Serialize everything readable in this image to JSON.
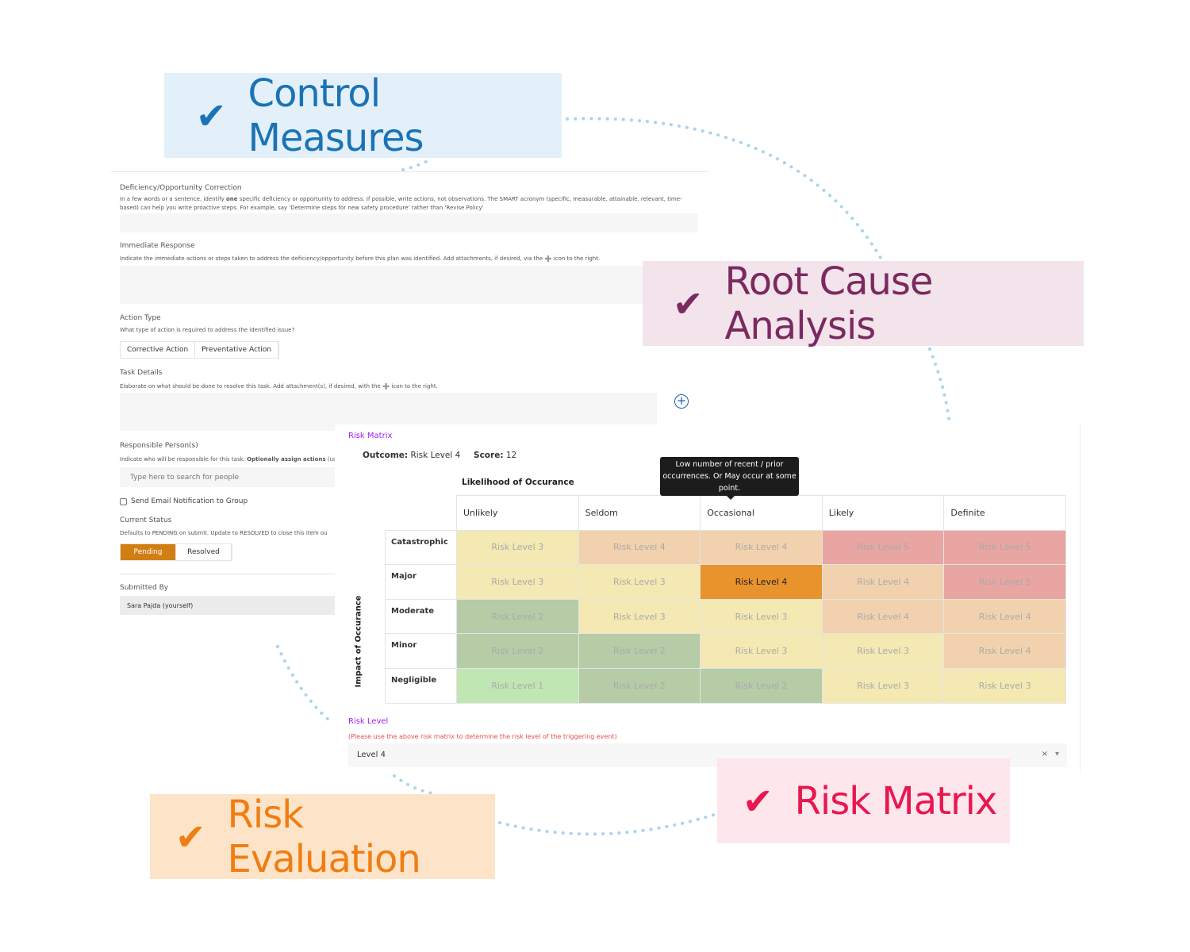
{
  "badges": {
    "control_measures": {
      "label": "Control Measures",
      "color": "#1a73b5",
      "bg": "#e3f0f9",
      "icon": "checkmark-icon"
    },
    "root_cause": {
      "label": "Root Cause Analysis",
      "color": "#7b2960",
      "bg": "#f2e4ea",
      "icon": "checkmark-icon"
    },
    "risk_matrix": {
      "label": "Risk Matrix",
      "color": "#e8174f",
      "bg": "#fde6ec",
      "icon": "checkmark-icon"
    },
    "risk_evaluation": {
      "label": "Risk Evaluation",
      "color": "#f07d12",
      "bg": "#fde4c9",
      "icon": "checkmark-icon"
    }
  },
  "form": {
    "deficiency": {
      "label": "Deficiency/Opportunity Correction",
      "hint_a": "In a few words or a sentence, identify ",
      "hint_bold": "one",
      "hint_b": " specific deficiency or opportunity to address.  If possible, write actions, not observations.  The SMART acronym (specific, measurable, attainable, relevant, time-based) can help you write proactive steps.  For example, say 'Determine steps for new safety procedure' rather than 'Revise Policy'"
    },
    "immediate": {
      "label": "Immediate Response",
      "hint_a": "Indicate the immediate actions or steps taken to address the deficiency/opportunity before this plan was identified.  Add attachments, if desired, via the ",
      "hint_b": " icon to the right."
    },
    "action_type": {
      "label": "Action Type",
      "hint": "What type of action is required to address the identified issue?",
      "options": [
        "Corrective Action",
        "Preventative Action"
      ]
    },
    "task_details": {
      "label": "Task Details",
      "hint_a": "Elaborate on what should be done to resolve this task.  Add attachment(s), if desired, with the ",
      "hint_b": " icon to the right."
    },
    "responsible": {
      "label": "Responsible Person(s)",
      "hint_a": "Indicate who will be responsible for this task.  ",
      "hint_bold": "Optionally assign actions",
      "hint_b": " (usi",
      "placeholder": "Type here to search for people"
    },
    "email_notification": "Send Email Notification to Group",
    "status": {
      "label": "Current Status",
      "hint": "Defaults to PENDING on submit.  Update to RESOLVED to close this item ou",
      "options": [
        "Pending",
        "Resolved"
      ],
      "selected": "Pending",
      "accent": "#d17f14"
    },
    "submitted_by": {
      "label": "Submitted By",
      "value": "Sara Pajda (yourself)"
    }
  },
  "matrix": {
    "title": "Risk Matrix",
    "outcome_label": "Outcome:",
    "outcome_value": "Risk Level 4",
    "score_label": "Score:",
    "score_value": "12",
    "likelihood_label": "Likelihood of Occurance",
    "impact_label": "Impact of Occurance",
    "tooltip": "Low number of recent / prior occurrences. Or May occur at some point.",
    "columns": [
      "Unlikely",
      "Seldom",
      "Occasional",
      "Likely",
      "Definite"
    ],
    "rows": [
      {
        "label": "Catastrophic",
        "levels": [
          3,
          4,
          4,
          5,
          5
        ]
      },
      {
        "label": "Major",
        "levels": [
          3,
          3,
          4,
          4,
          5
        ]
      },
      {
        "label": "Moderate",
        "levels": [
          2,
          3,
          3,
          4,
          4
        ]
      },
      {
        "label": "Minor",
        "levels": [
          2,
          2,
          3,
          3,
          4
        ]
      },
      {
        "label": "Negligible",
        "levels": [
          1,
          2,
          2,
          3,
          3
        ]
      }
    ],
    "cell_prefix": "Risk Level ",
    "selected": {
      "row": "Major",
      "column": "Occasional"
    }
  },
  "risk_level": {
    "label": "Risk Level",
    "hint": "(Please use the above risk matrix to determine the risk level of the triggering event)",
    "value": "Level 4",
    "clear": "×",
    "caret": "▾"
  },
  "colors": {
    "connector": "#a8d5ea",
    "purple": "#a020f0",
    "hint_red": "#e0524a"
  }
}
